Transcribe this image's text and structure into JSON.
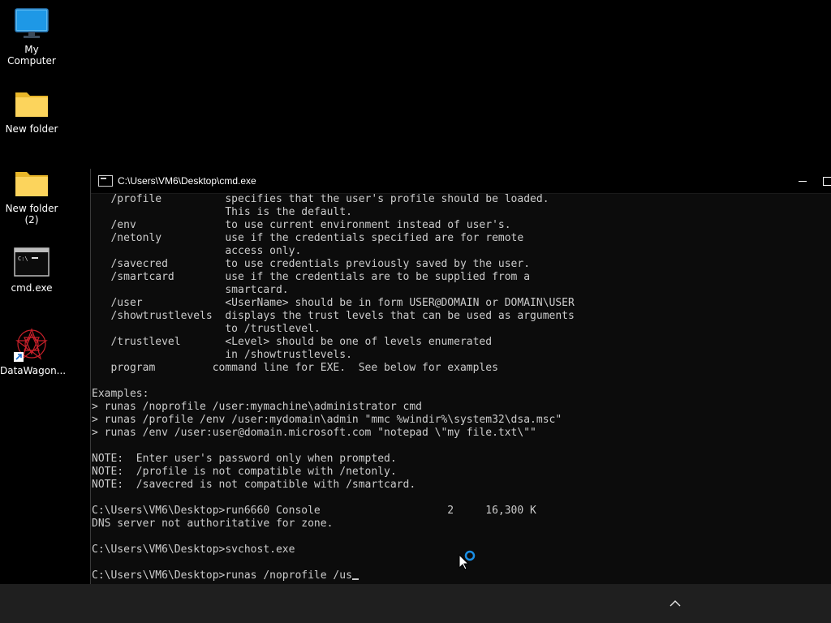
{
  "desktop": {
    "icons": [
      {
        "label": "My Computer",
        "icon": "monitor-icon"
      },
      {
        "label": "New folder",
        "icon": "folder-icon"
      },
      {
        "label": "New folder\n(2)",
        "icon": "folder-icon"
      },
      {
        "label": "cmd.exe",
        "icon": "cmd-icon"
      },
      {
        "label": "DataWagon...",
        "icon": "app-star-icon"
      }
    ]
  },
  "window": {
    "title": "C:\\Users\\VM6\\Desktop\\cmd.exe",
    "minimize": "minimize",
    "maximize": "maximize"
  },
  "terminal": {
    "lines": [
      "   /profile          specifies that the user's profile should be loaded.",
      "                     This is the default.",
      "   /env              to use current environment instead of user's.",
      "   /netonly          use if the credentials specified are for remote",
      "                     access only.",
      "   /savecred         to use credentials previously saved by the user.",
      "   /smartcard        use if the credentials are to be supplied from a",
      "                     smartcard.",
      "   /user             <UserName> should be in form USER@DOMAIN or DOMAIN\\USER",
      "   /showtrustlevels  displays the trust levels that can be used as arguments",
      "                     to /trustlevel.",
      "   /trustlevel       <Level> should be one of levels enumerated",
      "                     in /showtrustlevels.",
      "   program         command line for EXE.  See below for examples",
      "",
      "Examples:",
      "> runas /noprofile /user:mymachine\\administrator cmd",
      "> runas /profile /env /user:mydomain\\admin \"mmc %windir%\\system32\\dsa.msc\"",
      "> runas /env /user:user@domain.microsoft.com \"notepad \\\"my file.txt\\\"\"",
      "",
      "NOTE:  Enter user's password only when prompted.",
      "NOTE:  /profile is not compatible with /netonly.",
      "NOTE:  /savecred is not compatible with /smartcard.",
      "",
      "C:\\Users\\VM6\\Desktop>run6660 Console                    2     16,300 K",
      "DNS server not authoritative for zone.",
      "",
      "C:\\Users\\VM6\\Desktop>svchost.exe",
      ""
    ],
    "prompt_line": "C:\\Users\\VM6\\Desktop>runas /noprofile /us"
  },
  "taskbar": {
    "tray_icon": "chevron-up-icon"
  },
  "colors": {
    "console_bg": "#0c0c0c",
    "console_fg": "#cccccc",
    "taskbar_bg": "#1f1f1f"
  }
}
